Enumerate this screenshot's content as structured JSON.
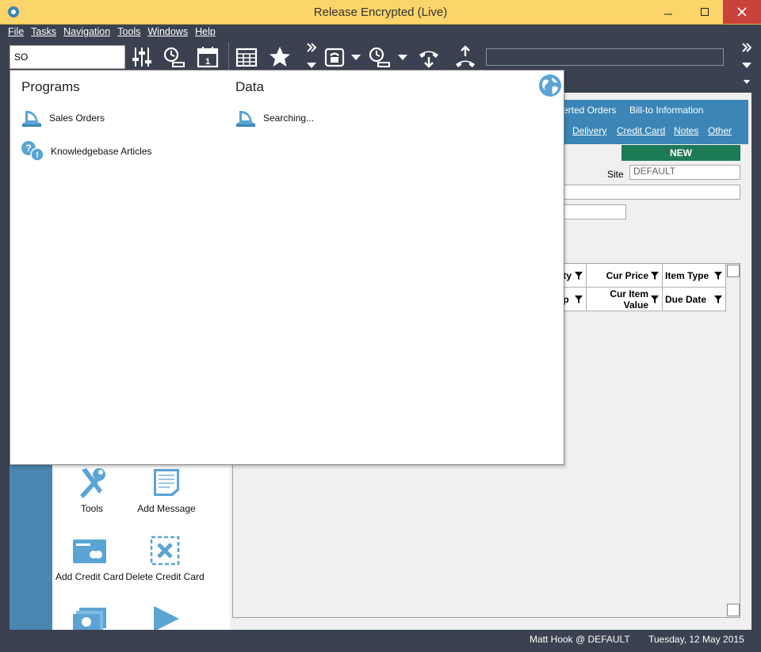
{
  "window": {
    "title": "Release Encrypted (Live)"
  },
  "menu": [
    "File",
    "Tasks",
    "Navigation",
    "Tools",
    "Windows",
    "Help"
  ],
  "search": {
    "value": "SO"
  },
  "popup": {
    "programs_heading": "Programs",
    "data_heading": "Data",
    "programs": [
      {
        "label": "Sales Orders",
        "icon": "cash-register-icon"
      },
      {
        "label": "Knowledgebase Articles",
        "icon": "question-bubble-icon"
      }
    ],
    "data_items": [
      {
        "label": "Searching...",
        "icon": "cash-register-icon"
      }
    ]
  },
  "tabs": {
    "row1": [
      "verted Orders",
      "Bill-to Information"
    ],
    "row2": [
      "Delivery",
      "Credit Card",
      "Notes",
      "Other"
    ]
  },
  "form": {
    "new_label": "NEW",
    "site_label": "Site",
    "site_value": "DEFAULT"
  },
  "grid": {
    "row1": [
      "ity",
      "Cur Price",
      "Item Type"
    ],
    "row2": [
      "ip",
      "Cur Item Value",
      "Due Date"
    ]
  },
  "actions": [
    {
      "label": "Tools",
      "icon": "wrench-screwdriver-icon"
    },
    {
      "label": "Add Message",
      "icon": "message-note-icon"
    },
    {
      "label": "Add Credit Card",
      "icon": "credit-card-icon"
    },
    {
      "label": "Delete Credit Card",
      "icon": "delete-x-icon"
    }
  ],
  "status": {
    "user": "Matt Hook @ DEFAULT",
    "date": "Tuesday, 12 May 2015"
  },
  "colors": {
    "titlebar": "#fbd46a",
    "chrome": "#3b4150",
    "accent_blue": "#3b86b7",
    "new_green": "#1d7a56",
    "icon_blue": "#5ba4d4",
    "close_red": "#c9413b"
  }
}
